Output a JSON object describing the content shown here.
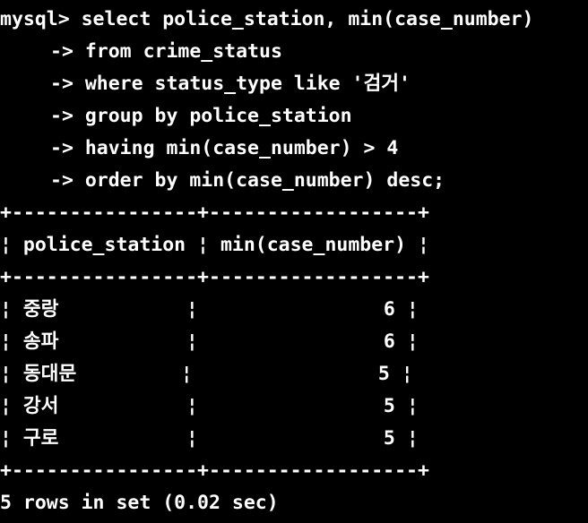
{
  "terminal": {
    "background": "#000000",
    "foreground": "#ffffff"
  },
  "query": {
    "prompt": "mysql> ",
    "line1": "select police_station, min(case_number)",
    "continuation": "-> ",
    "line2": "from crime_status",
    "line3": "where status_type like '검거'",
    "line4": "group by police_station",
    "line5": "having min(case_number) > 4",
    "line6": "order by min(case_number) desc;"
  },
  "table": {
    "border": "+----------------+------------------+",
    "columns": [
      "police_station",
      "min(case_number)"
    ],
    "rows": [
      {
        "police_station": "중랑",
        "min": "6"
      },
      {
        "police_station": "송파",
        "min": "6"
      },
      {
        "police_station": "동대문",
        "min": "5"
      },
      {
        "police_station": "강서",
        "min": "5"
      },
      {
        "police_station": "구로",
        "min": "5"
      }
    ]
  },
  "footer": "5 rows in set (0.02 sec)"
}
